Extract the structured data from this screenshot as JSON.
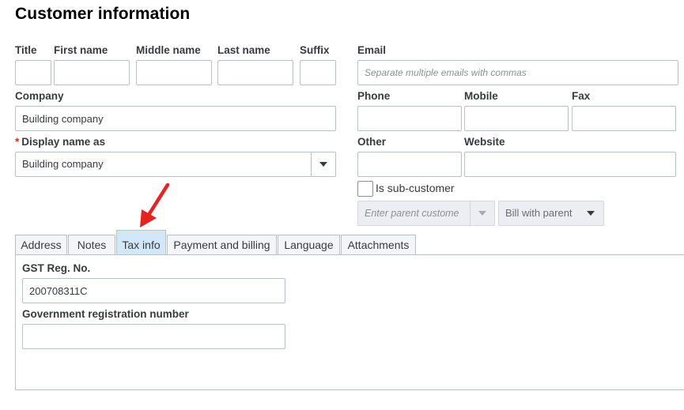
{
  "title": "Customer information",
  "name_fields": {
    "title_label": "Title",
    "first_label": "First name",
    "middle_label": "Middle name",
    "last_label": "Last name",
    "suffix_label": "Suffix"
  },
  "email": {
    "label": "Email",
    "placeholder": "Separate multiple emails with commas"
  },
  "company": {
    "label": "Company",
    "value": "Building company"
  },
  "display_name": {
    "required_mark": "*",
    "label": "Display name as",
    "value": "Building company"
  },
  "phone": {
    "phone_label": "Phone",
    "mobile_label": "Mobile",
    "fax_label": "Fax"
  },
  "other": {
    "other_label": "Other",
    "website_label": "Website"
  },
  "sub_customer": {
    "label": "Is sub-customer",
    "parent_placeholder": "Enter parent custome",
    "bill_option": "Bill with parent"
  },
  "tabs": [
    {
      "label": "Address"
    },
    {
      "label": "Notes"
    },
    {
      "label": "Tax info",
      "active": true
    },
    {
      "label": "Payment and billing"
    },
    {
      "label": "Language"
    },
    {
      "label": "Attachments"
    }
  ],
  "tax_info": {
    "gst_label": "GST Reg. No.",
    "gst_value": "200708311C",
    "gov_label": "Government registration number",
    "gov_value": ""
  },
  "annotation": {
    "arrow_color": "#e8231f"
  }
}
